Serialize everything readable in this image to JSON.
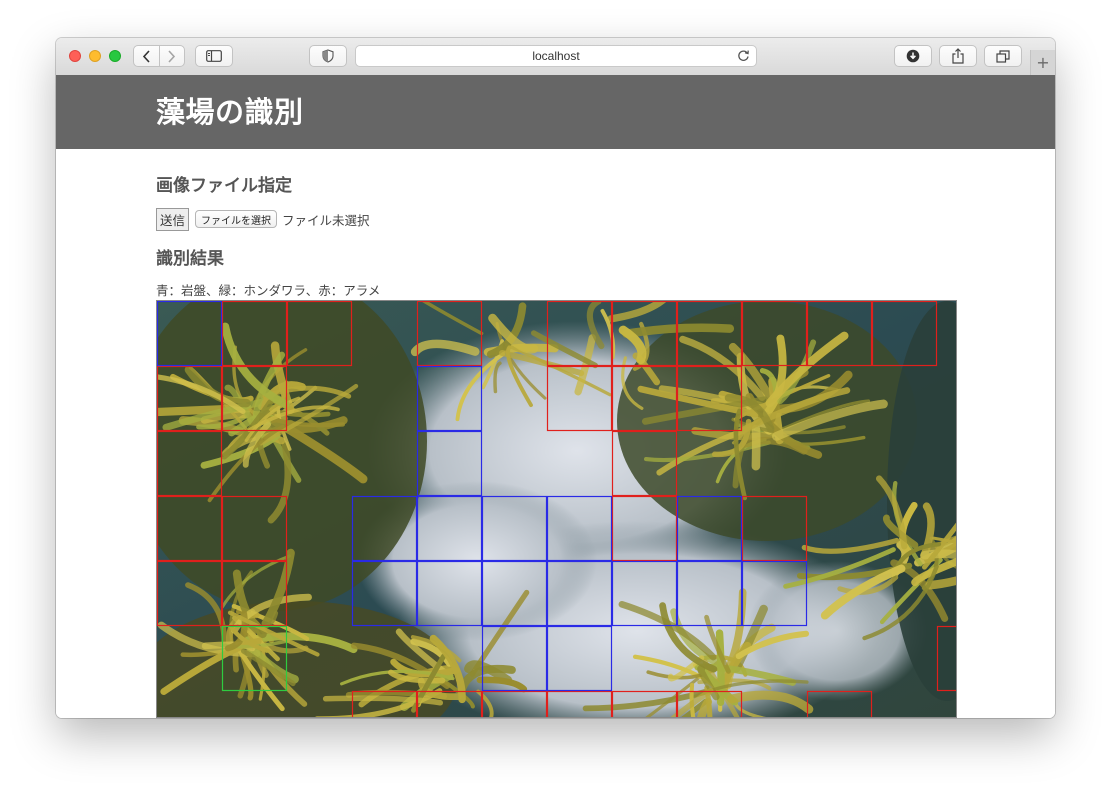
{
  "browser": {
    "url": "localhost",
    "icons": [
      "sidebar-icon",
      "shield-icon",
      "reload-icon",
      "download-icon",
      "share-icon",
      "tabs-icon",
      "plus-icon"
    ]
  },
  "page": {
    "title": "藻場の識別",
    "section_file": "画像ファイル指定",
    "submit_label": "送信",
    "choose_file_label": "ファイルを選択",
    "no_file_text": "ファイル未選択",
    "section_result": "識別結果",
    "legend_text": "青：岩盤、緑：ホンダワラ、赤：アラメ"
  },
  "classification": {
    "colors": {
      "rock": "#2a2ae6",
      "hondawara": "#2ecc40",
      "arame": "#e0201c"
    },
    "cell_size": 65,
    "rock_cells": [
      [
        0,
        0
      ],
      [
        4,
        1
      ],
      [
        4,
        2
      ],
      [
        3,
        3
      ],
      [
        4,
        3
      ],
      [
        5,
        3
      ],
      [
        6,
        3
      ],
      [
        8,
        3
      ],
      [
        3,
        4
      ],
      [
        4,
        4
      ],
      [
        5,
        4
      ],
      [
        6,
        4
      ],
      [
        7,
        4
      ],
      [
        8,
        4
      ],
      [
        9,
        4
      ],
      [
        5,
        5
      ],
      [
        6,
        5
      ]
    ],
    "hondawara_cells": [
      [
        1,
        5
      ]
    ],
    "arame_cells": [
      [
        1,
        0
      ],
      [
        2,
        0
      ],
      [
        4,
        0
      ],
      [
        6,
        0
      ],
      [
        7,
        0
      ],
      [
        8,
        0
      ],
      [
        9,
        0
      ],
      [
        10,
        0
      ],
      [
        11,
        0
      ],
      [
        0,
        1
      ],
      [
        1,
        1
      ],
      [
        6,
        1
      ],
      [
        7,
        1
      ],
      [
        8,
        1
      ],
      [
        0,
        2
      ],
      [
        7,
        2
      ],
      [
        0,
        3
      ],
      [
        1,
        3
      ],
      [
        7,
        3
      ],
      [
        9,
        3
      ],
      [
        0,
        4
      ],
      [
        1,
        4
      ],
      [
        12,
        5
      ],
      [
        3,
        6
      ],
      [
        4,
        6
      ],
      [
        5,
        6
      ],
      [
        6,
        6
      ],
      [
        7,
        6
      ],
      [
        8,
        6
      ],
      [
        10,
        6
      ]
    ]
  }
}
